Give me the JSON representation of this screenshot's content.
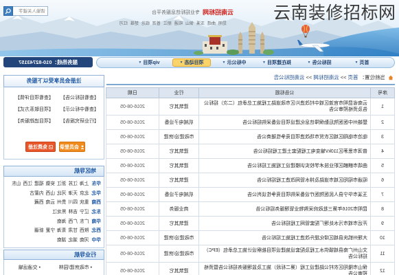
{
  "overlay_caption": "云南装修招标网",
  "colors": {
    "brand_red": "#d0201b",
    "nav_active": "#fbd36b",
    "hotline_bg": "#22457c",
    "button_orange": "#f08b1d"
  },
  "header": {
    "site_name": "云南招标网",
    "slogan": "专业招标信息服务平台",
    "city_links": [
      "昆明",
      "曲靖",
      "玉溪",
      "保山",
      "昭通",
      "丽江",
      "普洱",
      "临沧",
      "楚雄",
      "红河"
    ],
    "search": {
      "placeholder": "请输入关键字",
      "icon": "search-icon"
    }
  },
  "nav": {
    "items": [
      {
        "label": "首页",
        "active": false
      },
      {
        "label": "招标公告",
        "active": false
      },
      {
        "label": "拟在建项目",
        "active": false
      },
      {
        "label": "中标公示",
        "active": false
      },
      {
        "label": "项目动态",
        "active": true
      },
      {
        "label": "vip项目",
        "active": false
      }
    ]
  },
  "hotline": "服务热线：010-82743157",
  "breadcrumb": {
    "icon": "home-icon",
    "prefix": "当前位置：",
    "separator": ">>",
    "items": [
      "首页",
      "云南招标网",
      "云南招标公告"
    ]
  },
  "notice_table": {
    "columns": [
      "序号",
      "公告标题",
      "行业",
      "日期"
    ],
    "rows": [
      {
        "no": "1",
        "title": "云南省昆明市官渡区城中村改造片区市政道路工程施工总承包（二次）招标公告及资格预审公告",
        "industry": "建筑其它",
        "date": "2016-08-05"
      },
      {
        "no": "2",
        "title": "楚雄州中医医院后勤保障信息化建设项目设备采购招标公告",
        "industry": "机械电子设备",
        "date": "2016-08-05"
      },
      {
        "no": "3",
        "title": "临沧市临翔区城区农贸市场改造项目竞争性磋商公告",
        "industry": "市政建设/房建",
        "date": "2016-08-05"
      },
      {
        "no": "4",
        "title": "普洱市思茅区110kV输变电工程配套土建工程招标公告",
        "industry": "建筑其它",
        "date": "2016-08-05"
      },
      {
        "no": "5",
        "title": "曲靖市麒麟区职业技术学校实训楼建设工程施工招标公告",
        "industry": "建筑其它",
        "date": "2016-08-05"
      },
      {
        "no": "6",
        "title": "昭通市昭阳区城市道路及排水管网改造工程招标公告",
        "industry": "建筑其它",
        "date": "2016-08-05"
      },
      {
        "no": "7",
        "title": "玉溪市华宁县人民医院医疗设备采购项目竞争性谈判公告",
        "industry": "机械电子设备",
        "date": "2016-08-05"
      },
      {
        "no": "8",
        "title": "昆明市2016年第三批政府采购物业管理服务招标公告",
        "industry": "商业服务",
        "date": "2016-08-05"
      },
      {
        "no": "9",
        "title": "开远市城市污水处理厂配套管网工程招标公告",
        "industry": "建筑其它",
        "date": "2016-08-05"
      },
      {
        "no": "10",
        "title": "大理州鹤庆县城区绿化提升改造工程施工招标公告",
        "industry": "市政建设/房建",
        "date": "2016-08-05"
      },
      {
        "no": "11",
        "title": "文山州广南县城镇供水工程及配套设施建设项目勘察设计施工总承包（EPC）招标公告",
        "industry": "市政建设/房建",
        "date": "2016-08-05"
      },
      {
        "no": "12",
        "title": "保山市隆阳区农村公路建设工程（第二标段）施工及监理服务招标公告暨资格预审公告",
        "industry": "建筑其它",
        "date": "2016-08-05"
      }
    ]
  },
  "member_box": {
    "title": "注册会员享受以下服务",
    "services": [
      "【查看招标公告】",
      "【查看项目详情】",
      "【查看中标公示】",
      "【项目联系方式】",
      "【行业研究报告】",
      "【项目追踪服务】"
    ],
    "login_label": "会员登录",
    "register_label": "免费注册"
  },
  "region_nav": {
    "title": "地区导航",
    "regions": [
      {
        "name": "华东",
        "provinces": [
          "上海",
          "江苏",
          "浙江",
          "安徽",
          "福建",
          "江西",
          "山东"
        ]
      },
      {
        "name": "华北",
        "provinces": [
          "北京",
          "天津",
          "河北",
          "山西",
          "内蒙古"
        ]
      },
      {
        "name": "西南",
        "provinces": [
          "重庆",
          "四川",
          "贵州",
          "云南",
          "西藏"
        ]
      },
      {
        "name": "东北",
        "provinces": [
          "辽宁",
          "吉林",
          "黑龙江"
        ]
      },
      {
        "name": "华南",
        "provinces": [
          "广东",
          "广西",
          "海南"
        ]
      },
      {
        "name": "西北",
        "provinces": [
          "陕西",
          "甘肃",
          "青海",
          "宁夏",
          "新疆"
        ]
      },
      {
        "name": "华中",
        "provinces": [
          "河南",
          "湖北",
          "湖南"
        ]
      }
    ]
  },
  "industry_nav": {
    "title": "行业导航",
    "items": [
      "市政房建/园林",
      "交通运输"
    ]
  }
}
